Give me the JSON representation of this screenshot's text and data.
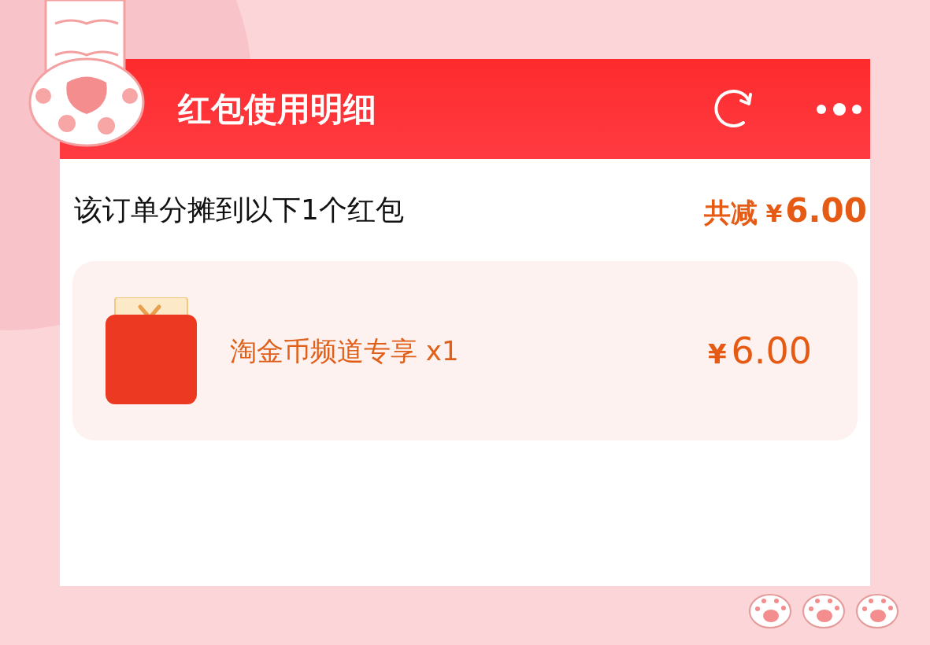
{
  "header": {
    "title": "红包使用明细"
  },
  "summary": {
    "text": "该订单分摊到以下1个红包",
    "total_label": "共减",
    "currency": "¥",
    "amount": "6.00"
  },
  "coupons": [
    {
      "name": "淘金币频道专享 x1",
      "currency": "¥",
      "amount": "6.00"
    }
  ]
}
